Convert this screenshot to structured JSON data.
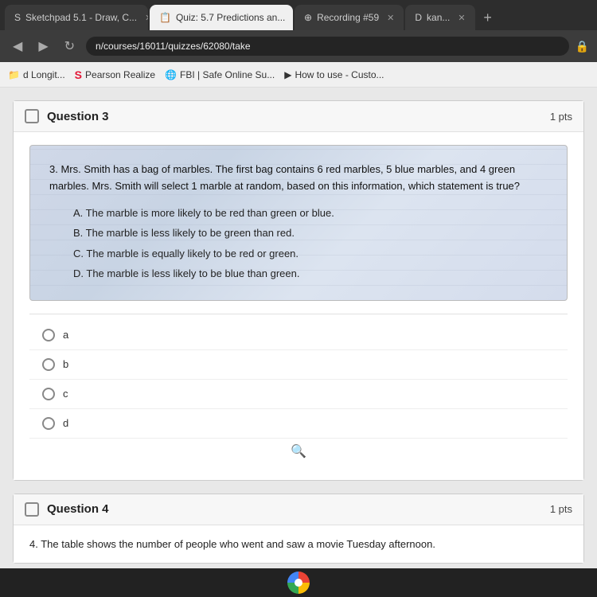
{
  "browser": {
    "tabs": [
      {
        "id": "tab1",
        "label": "Sketchpad 5.1 - Draw, C...",
        "icon": "S",
        "active": false
      },
      {
        "id": "tab2",
        "label": "Quiz: 5.7 Predictions an...",
        "icon": "📋",
        "active": true
      },
      {
        "id": "tab3",
        "label": "Recording #59",
        "icon": "⊕",
        "active": false
      },
      {
        "id": "tab4",
        "label": "kan...",
        "icon": "D",
        "active": false
      }
    ],
    "address": "n/courses/16011/quizzes/62080/take",
    "bookmarks": [
      {
        "label": "d Longit...",
        "icon": ""
      },
      {
        "label": "Pearson Realize",
        "icon": "S"
      },
      {
        "label": "FBI | Safe Online Su...",
        "icon": "🌐"
      },
      {
        "label": "How to use - Custo...",
        "icon": "▶"
      }
    ]
  },
  "question3": {
    "number": "Question 3",
    "points": "1 pts",
    "body": "3. Mrs. Smith has a bag of marbles.  The first bag contains 6 red marbles, 5 blue marbles, and 4 green marbles.  Mrs. Smith will select 1 marble at random, based on this information, which statement is true?",
    "choices": [
      {
        "label": "A. The marble is more likely to be red than green or blue."
      },
      {
        "label": "B. The marble is less likely to be green than red."
      },
      {
        "label": "C. The marble is equally likely to be red or green."
      },
      {
        "label": "D. The marble is less likely to be blue than green."
      }
    ],
    "options": [
      {
        "value": "a",
        "label": "a"
      },
      {
        "value": "b",
        "label": "b"
      },
      {
        "value": "c",
        "label": "c"
      },
      {
        "value": "d",
        "label": "d"
      }
    ]
  },
  "question4": {
    "number": "Question 4",
    "points": "1 pts",
    "body": "4. The table shows the number of people who went and saw a movie Tuesday afternoon."
  },
  "taskbar": {}
}
